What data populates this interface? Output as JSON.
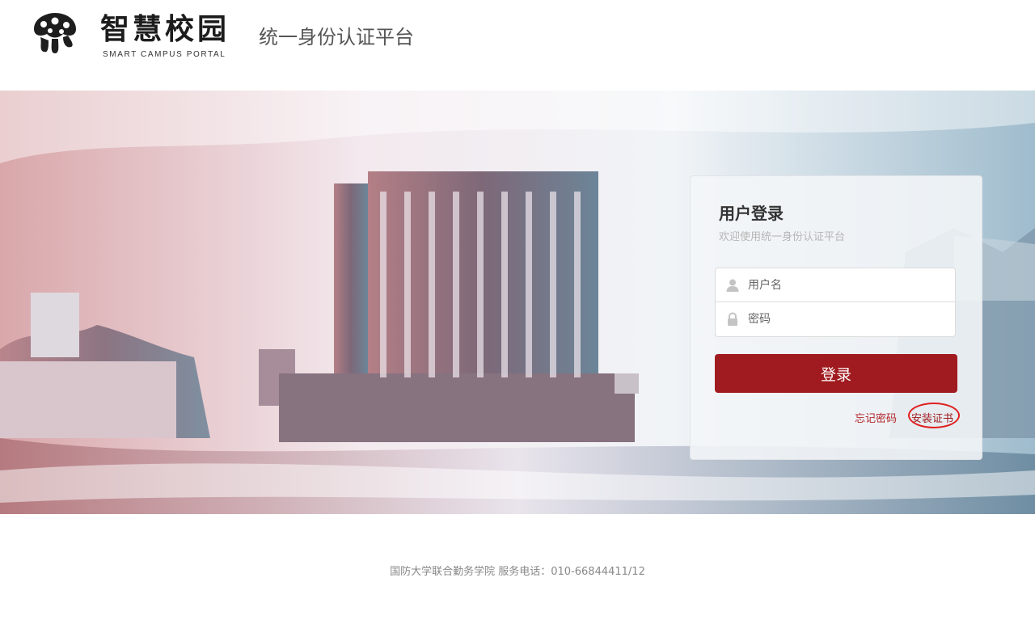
{
  "header": {
    "logo_title": "智慧校园",
    "logo_subtitle": "SMART CAMPUS PORTAL",
    "platform_title": "统一身份认证平台"
  },
  "login": {
    "title": "用户登录",
    "subtitle": "欢迎使用统一身份认证平台",
    "username_placeholder": "用户名",
    "password_placeholder": "密码",
    "login_label": "登录",
    "forgot_label": "忘记密码",
    "install_cert_label": "安装证书"
  },
  "footer": {
    "text": "国防大学联合勤务学院 服务电话：010-66844411/12"
  },
  "colors": {
    "accent": "#a01b1f",
    "link": "#b2262a",
    "annotation_ring": "#e02020"
  }
}
